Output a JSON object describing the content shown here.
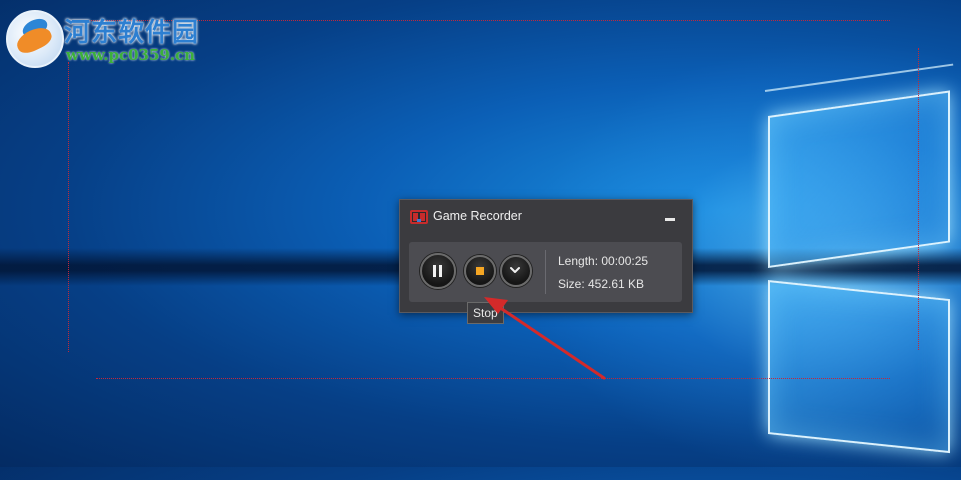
{
  "watermark": {
    "site_name": "河东软件园",
    "url": "www.pc0359.cn"
  },
  "recorder": {
    "title": "Game Recorder",
    "length_label": "Length: 00:00:25",
    "size_label": "Size: 452.61 KB",
    "tooltip": "Stop",
    "icons": {
      "app": "game-recorder-logo-icon",
      "minimize": "minimize-icon",
      "pause": "pause-icon",
      "stop": "stop-icon",
      "more": "chevron-down-icon"
    }
  },
  "colors": {
    "stop_accent": "#f5a623",
    "annotation_arrow": "#d42a2a",
    "capture_region_border": "#c0283e",
    "window_bg": "#3b3b3f"
  }
}
